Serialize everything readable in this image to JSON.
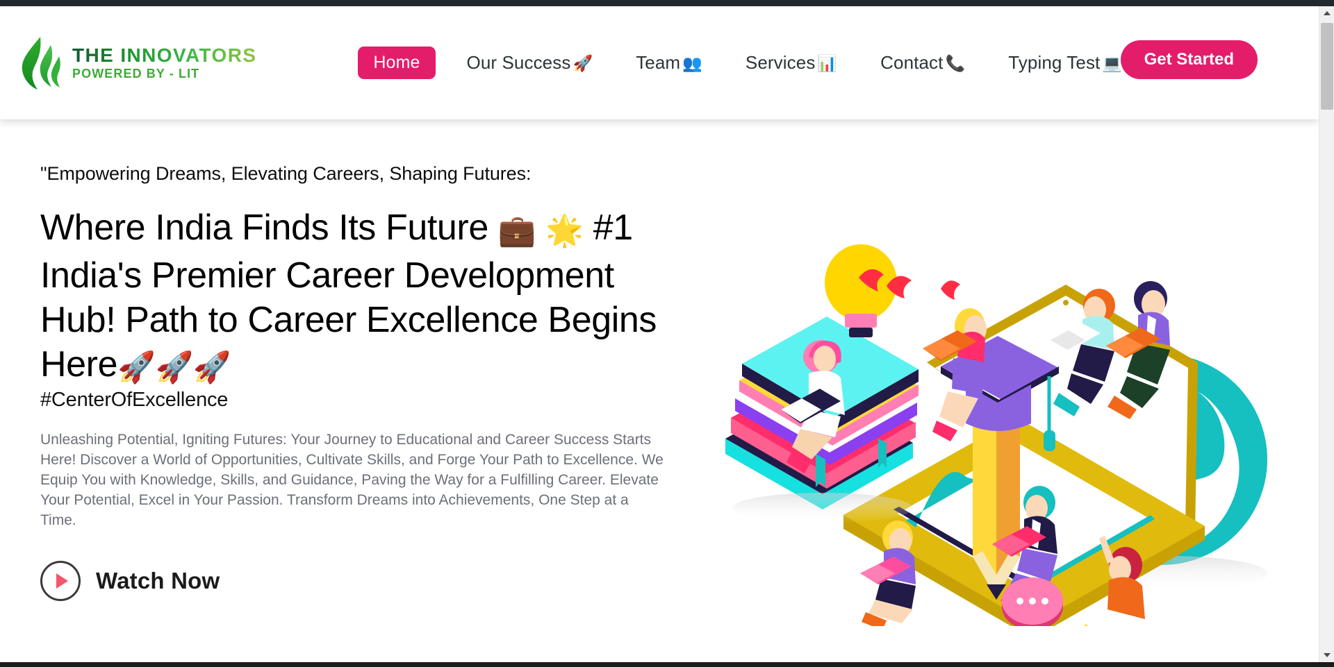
{
  "brand": {
    "title": "THE INNOVATORS",
    "subtitle": "POWERED BY - LIT",
    "mark": "green-flame-logo"
  },
  "nav": {
    "items": [
      {
        "label": "Home",
        "emoji": "",
        "active": true
      },
      {
        "label": "Our Success",
        "emoji": "🚀",
        "active": false
      },
      {
        "label": "Team",
        "emoji": "👥",
        "active": false
      },
      {
        "label": "Services",
        "emoji": "📊",
        "active": false
      },
      {
        "label": "Contact",
        "emoji": "📞",
        "active": false
      },
      {
        "label": "Typing Test",
        "emoji": "💻",
        "active": false
      }
    ],
    "cta_label": "Get Started"
  },
  "hero": {
    "kicker": "\"Empowering Dreams, Elevating Careers, Shaping Futures:",
    "headline_part1": "Where India Finds Its Future ",
    "headline_emoji1": "💼",
    "headline_emoji2": "🌟",
    "headline_part2": " #1 India's Premier Career Development Hub! Path to Career Excellence Begins Here",
    "headline_emoji3": "🚀🚀🚀",
    "hashtag": "#CenterOfExcellence",
    "lede": "Unleashing Potential, Igniting Futures: Your Journey to Educational and Career Success Starts Here! Discover a World of Opportunities, Cultivate Skills, and Forge Your Path to Excellence. We Equip You with Knowledge, Skills, and Guidance, Paving the Way for a Fulfilling Career. Elevate Your Potential, Excel in Your Passion. Transform Dreams into Achievements, One Step at a Time.",
    "watch_label": "Watch Now",
    "illustration": "isometric-education-books-laptop-globe-people"
  },
  "colors": {
    "accent_pink": "#e41d6b",
    "brand_green": "#3faa35",
    "body_text": "#6c6f7a",
    "heading": "#000000",
    "play_icon": "#f4566b"
  },
  "scrollbar": {
    "up_icon": "chevron-up-icon",
    "down_icon": "chevron-down-icon"
  }
}
